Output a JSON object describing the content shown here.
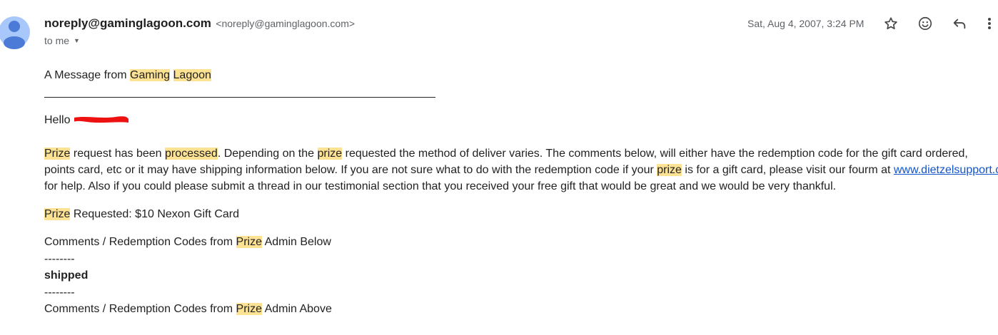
{
  "sender": {
    "name": "noreply@gaminglagoon.com",
    "email": "<noreply@gaminglagoon.com>",
    "recipient_label": "to me"
  },
  "date": "Sat, Aug 4, 2007, 3:24 PM",
  "toolbar": {
    "icons": [
      "star-icon",
      "emoji-icon",
      "reply-icon",
      "more-vert-icon"
    ]
  },
  "colors": {
    "highlight": "#fde293",
    "link": "#1155cc",
    "redaction": "#ee1111"
  },
  "message": {
    "heading_prefix": "A Message from ",
    "heading_hl1": "Gaming",
    "heading_hl2": "Lagoon",
    "greeting": "Hello",
    "p1": {
      "hl_prize": "Prize",
      "t1": " request has been ",
      "hl_processed": "processed",
      "t2": ". Depending on the ",
      "hl_prize2": "prize",
      "t3": " requested the method of deliver varies. The comments below, will either have the redemption code for the gift card ordered,",
      "line2_pre": "points card, etc or it may have shipping information below. If you are not sure what to do with the redemption code if your ",
      "hl_prize3": "prize",
      "line2_mid": " is for a gift card, please visit our fourm at ",
      "link": "www.dietzelsupport.com",
      "line3": "for help. Also if you could please submit a thread in our testimonial section that you received your free gift that would be great and we would be very thankful."
    },
    "prize_requested": {
      "hl": "Prize",
      "text": " Requested: $10 Nexon Gift Card"
    },
    "comments_below": {
      "pre": "Comments / Redemption Codes from ",
      "hl": "Prize",
      "post": " Admin Below"
    },
    "separator": "--------",
    "status": "shipped",
    "comments_above": {
      "pre": "Comments / Redemption Codes from ",
      "hl": "Prize",
      "post": " Admin Above"
    }
  }
}
